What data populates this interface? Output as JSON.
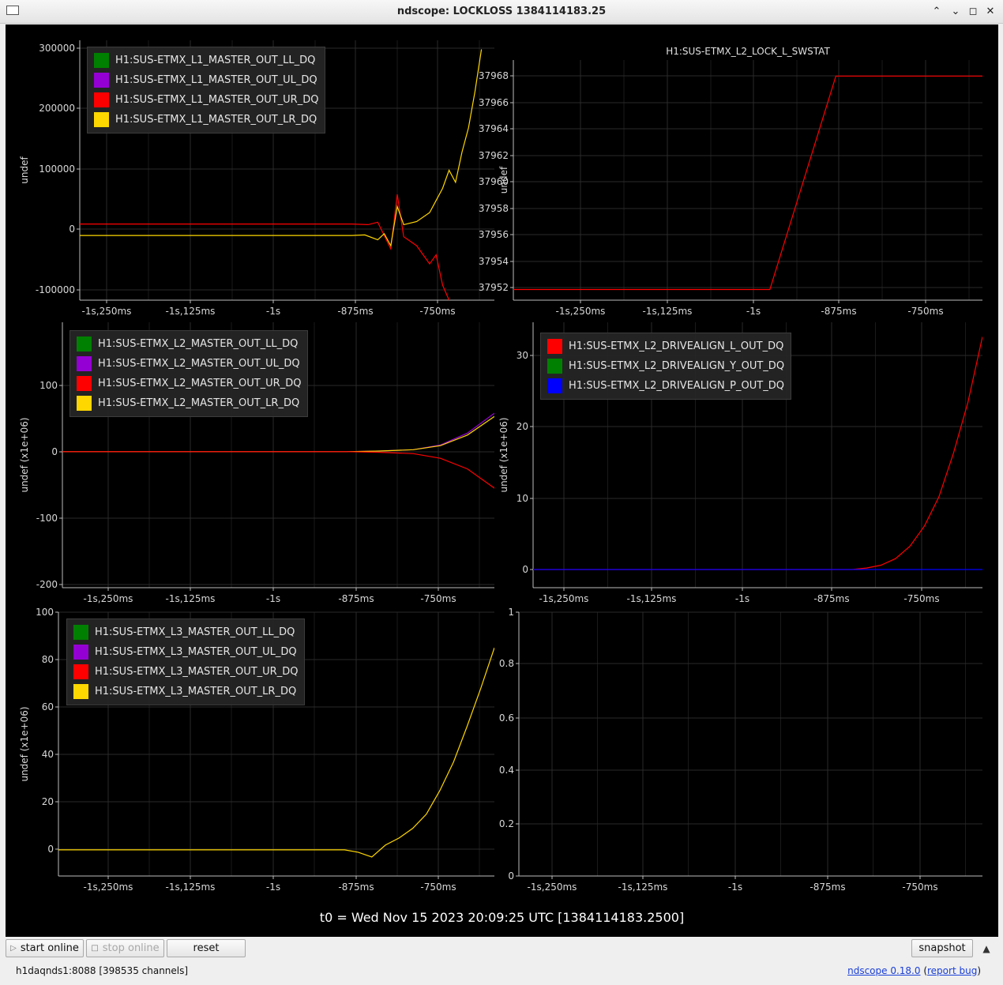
{
  "window": {
    "title": "ndscope: LOCKLOSS 1384114183.25",
    "controls": [
      "⌃",
      "⌄",
      "◻",
      "✕"
    ]
  },
  "colors": {
    "green": "#008000",
    "purple": "#9400d3",
    "red": "#ff0000",
    "yellow": "#ffd700",
    "blue": "#0000ff"
  },
  "plots": [
    {
      "id": "l1",
      "title": "",
      "ylabel": "undef",
      "y_ticks": [
        "300000",
        "200000",
        "100000",
        "0",
        "-100000"
      ],
      "x_ticks": [
        "-1s,250ms",
        "-1s,125ms",
        "-1s",
        "-875ms",
        "-750ms"
      ],
      "legend": [
        {
          "label": "H1:SUS-ETMX_L1_MASTER_OUT_LL_DQ",
          "color": "#008000"
        },
        {
          "label": "H1:SUS-ETMX_L1_MASTER_OUT_UL_DQ",
          "color": "#9400d3"
        },
        {
          "label": "H1:SUS-ETMX_L1_MASTER_OUT_UR_DQ",
          "color": "#ff0000"
        },
        {
          "label": "H1:SUS-ETMX_L1_MASTER_OUT_LR_DQ",
          "color": "#ffd700"
        }
      ]
    },
    {
      "id": "swstat",
      "title": "H1:SUS-ETMX_L2_LOCK_L_SWSTAT",
      "ylabel": "undef",
      "y_ticks": [
        "37968",
        "37966",
        "37964",
        "37962",
        "37960",
        "37958",
        "37956",
        "37954",
        "37952"
      ],
      "x_ticks": [
        "-1s,250ms",
        "-1s,125ms",
        "-1s",
        "-875ms",
        "-750ms"
      ],
      "legend": []
    },
    {
      "id": "l2",
      "title": "",
      "ylabel": "undef (x1e+06)",
      "y_ticks": [
        "100",
        "0",
        "-100",
        "-200"
      ],
      "x_ticks": [
        "-1s,250ms",
        "-1s,125ms",
        "-1s",
        "-875ms",
        "-750ms"
      ],
      "legend": [
        {
          "label": "H1:SUS-ETMX_L2_MASTER_OUT_LL_DQ",
          "color": "#008000"
        },
        {
          "label": "H1:SUS-ETMX_L2_MASTER_OUT_UL_DQ",
          "color": "#9400d3"
        },
        {
          "label": "H1:SUS-ETMX_L2_MASTER_OUT_UR_DQ",
          "color": "#ff0000"
        },
        {
          "label": "H1:SUS-ETMX_L2_MASTER_OUT_LR_DQ",
          "color": "#ffd700"
        }
      ]
    },
    {
      "id": "drivealign",
      "title": "",
      "ylabel": "undef (x1e+06)",
      "y_ticks": [
        "30",
        "20",
        "10",
        "0"
      ],
      "x_ticks": [
        "-1s,250ms",
        "-1s,125ms",
        "-1s",
        "-875ms",
        "-750ms"
      ],
      "legend": [
        {
          "label": "H1:SUS-ETMX_L2_DRIVEALIGN_L_OUT_DQ",
          "color": "#ff0000"
        },
        {
          "label": "H1:SUS-ETMX_L2_DRIVEALIGN_Y_OUT_DQ",
          "color": "#008000"
        },
        {
          "label": "H1:SUS-ETMX_L2_DRIVEALIGN_P_OUT_DQ",
          "color": "#0000ff"
        }
      ]
    },
    {
      "id": "l3",
      "title": "",
      "ylabel": "undef (x1e+06)",
      "y_ticks": [
        "100",
        "80",
        "60",
        "40",
        "20",
        "0"
      ],
      "x_ticks": [
        "-1s,250ms",
        "-1s,125ms",
        "-1s",
        "-875ms",
        "-750ms"
      ],
      "legend": [
        {
          "label": "H1:SUS-ETMX_L3_MASTER_OUT_LL_DQ",
          "color": "#008000"
        },
        {
          "label": "H1:SUS-ETMX_L3_MASTER_OUT_UL_DQ",
          "color": "#9400d3"
        },
        {
          "label": "H1:SUS-ETMX_L3_MASTER_OUT_UR_DQ",
          "color": "#ff0000"
        },
        {
          "label": "H1:SUS-ETMX_L3_MASTER_OUT_LR_DQ",
          "color": "#ffd700"
        }
      ]
    },
    {
      "id": "empty",
      "title": "",
      "ylabel": "",
      "y_ticks": [
        "1",
        "0.8",
        "0.6",
        "0.4",
        "0.2",
        "0"
      ],
      "x_ticks": [
        "-1s,250ms",
        "-1s,125ms",
        "-1s",
        "-875ms",
        "-750ms"
      ],
      "legend": []
    }
  ],
  "chart_data": [
    {
      "type": "line",
      "id": "l1",
      "x_unit": "s",
      "xlim": [
        -1.32,
        -0.68
      ],
      "ylim": [
        -115000,
        315000
      ],
      "series": [
        {
          "name": "H1:SUS-ETMX_L1_MASTER_OUT_UR_DQ",
          "color": "#ff0000",
          "x": [
            -1.32,
            -0.9,
            -0.875,
            -0.86,
            -0.84,
            -0.83,
            -0.82,
            -0.8,
            -0.78,
            -0.77,
            -0.76,
            -0.75
          ],
          "y": [
            11000,
            11000,
            10000,
            14000,
            -30000,
            60000,
            -10000,
            -25000,
            -55000,
            -40000,
            -90000,
            -115000
          ]
        },
        {
          "name": "H1:SUS-ETMX_L1_MASTER_OUT_LR_DQ",
          "color": "#ffd700",
          "x": [
            -1.32,
            -0.9,
            -0.88,
            -0.86,
            -0.85,
            -0.84,
            -0.83,
            -0.82,
            -0.8,
            -0.78,
            -0.77,
            -0.76,
            -0.75,
            -0.74,
            -0.73,
            -0.72,
            -0.71,
            -0.7
          ],
          "y": [
            -8000,
            -8000,
            -7000,
            -15000,
            -5000,
            -25000,
            40000,
            10000,
            15000,
            30000,
            50000,
            70000,
            100000,
            80000,
            130000,
            170000,
            230000,
            300000
          ]
        }
      ]
    },
    {
      "type": "line",
      "id": "swstat",
      "x_unit": "s",
      "xlim": [
        -1.32,
        -0.68
      ],
      "ylim": [
        37951.2,
        37969.2
      ],
      "series": [
        {
          "name": "H1:SUS-ETMX_L2_LOCK_L_SWSTAT",
          "color": "#ff0000",
          "x": [
            -1.32,
            -0.97,
            -0.88,
            -0.68
          ],
          "y": [
            37952,
            37952,
            37968,
            37968
          ]
        }
      ]
    },
    {
      "type": "line",
      "id": "l2",
      "x_unit": "s",
      "xlim": [
        -1.32,
        -0.68
      ],
      "ylim": [
        -205,
        195
      ],
      "series": [
        {
          "name": "H1:SUS-ETMX_L2_MASTER_OUT_UL_DQ",
          "color": "#9400d3",
          "x": [
            -1.32,
            -0.9,
            -0.85,
            -0.8,
            -0.76,
            -0.72,
            -0.68
          ],
          "y": [
            0,
            0,
            1,
            3,
            10,
            28,
            58
          ]
        },
        {
          "name": "H1:SUS-ETMX_L2_MASTER_OUT_LR_DQ",
          "color": "#ffd700",
          "x": [
            -1.32,
            -0.9,
            -0.85,
            -0.8,
            -0.76,
            -0.72,
            -0.68
          ],
          "y": [
            0,
            0,
            1,
            3,
            9,
            25,
            53
          ]
        },
        {
          "name": "H1:SUS-ETMX_L2_MASTER_OUT_UR_DQ",
          "color": "#ff0000",
          "x": [
            -1.32,
            -0.9,
            -0.85,
            -0.8,
            -0.76,
            -0.72,
            -0.68
          ],
          "y": [
            0,
            0,
            -1,
            -3,
            -10,
            -26,
            -55
          ]
        }
      ]
    },
    {
      "type": "line",
      "id": "drivealign",
      "x_unit": "s",
      "xlim": [
        -1.3,
        -0.68
      ],
      "ylim": [
        -2.5,
        34
      ],
      "series": [
        {
          "name": "H1:SUS-ETMX_L2_DRIVEALIGN_L_OUT_DQ",
          "color": "#ff0000",
          "x": [
            -1.3,
            -0.88,
            -0.86,
            -0.84,
            -0.82,
            -0.8,
            -0.78,
            -0.76,
            -0.74,
            -0.72,
            -0.7,
            -0.68
          ],
          "y": [
            0,
            0,
            0,
            0.2,
            0.6,
            1.5,
            3.2,
            6,
            10,
            16,
            23,
            32
          ]
        },
        {
          "name": "H1:SUS-ETMX_L2_DRIVEALIGN_P_OUT_DQ",
          "color": "#0000ff",
          "x": [
            -1.3,
            -0.68
          ],
          "y": [
            0,
            0
          ]
        }
      ]
    },
    {
      "type": "line",
      "id": "l3",
      "x_unit": "s",
      "xlim": [
        -1.32,
        -0.68
      ],
      "ylim": [
        -11,
        100
      ],
      "series": [
        {
          "name": "H1:SUS-ETMX_L3_MASTER_OUT_LR_DQ",
          "color": "#ffd700",
          "x": [
            -1.32,
            -0.9,
            -0.88,
            -0.86,
            -0.84,
            -0.82,
            -0.8,
            -0.78,
            -0.76,
            -0.74,
            -0.72,
            -0.7,
            -0.68
          ],
          "y": [
            0,
            0,
            -1,
            -3,
            2,
            5,
            9,
            15,
            25,
            37,
            52,
            68,
            85
          ]
        }
      ]
    },
    {
      "type": "line",
      "id": "empty",
      "xlim": [
        -1.3,
        -0.68
      ],
      "ylim": [
        0,
        1
      ],
      "series": []
    }
  ],
  "t0_label": "t0 = Wed Nov 15 2023 20:09:25 UTC [1384114183.2500]",
  "buttons": {
    "start_online": "start online",
    "stop_online": "stop online",
    "reset": "reset",
    "snapshot": "snapshot",
    "expand": "▲"
  },
  "status": {
    "server": "h1daqnds1:8088  [398535 channels]",
    "version": "ndscope 0.18.0",
    "paren_open": " (",
    "report_bug": "report bug",
    "paren_close": ")"
  }
}
